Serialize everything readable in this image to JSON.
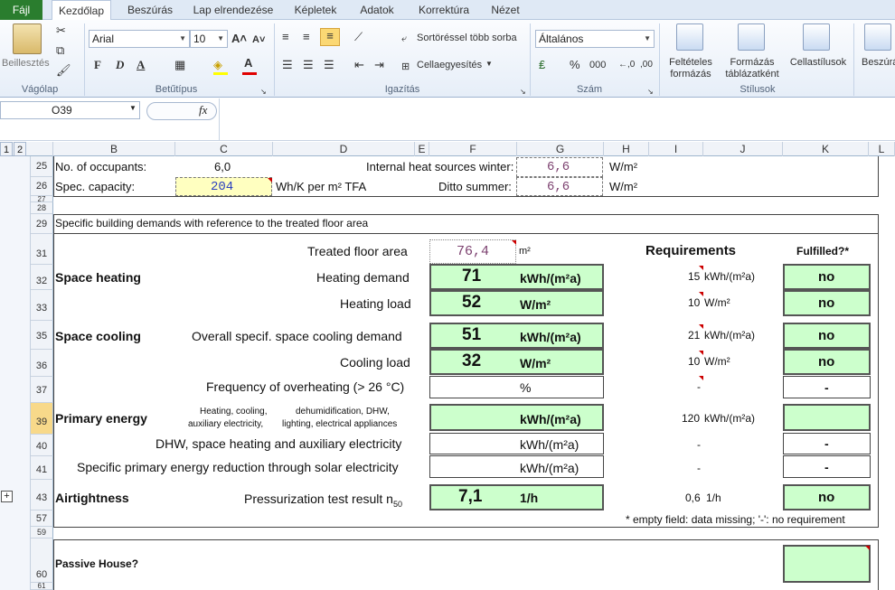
{
  "ribbon": {
    "file_tab": "Fájl",
    "tabs": [
      "Kezdőlap",
      "Beszúrás",
      "Lap elrendezése",
      "Képletek",
      "Adatok",
      "Korrektúra",
      "Nézet"
    ],
    "paste_label": "Beillesztés",
    "font_name": "Arial",
    "font_size": "10",
    "bold_btn": "F",
    "italic_btn": "D",
    "underline_btn": "A",
    "wrap_label": "Sortöréssel több sorba",
    "merge_label": "Cellaegyesítés",
    "number_format": "Általános",
    "percent": "%",
    "thousands": "000",
    "cond_format_l1": "Feltételes",
    "cond_format_l2": "formázás",
    "table_format_l1": "Formázás",
    "table_format_l2": "táblázatként",
    "cell_styles": "Cellastílusok",
    "insert_label": "Beszúrá",
    "groups": [
      "Vágólap",
      "Betűtípus",
      "Igazítás",
      "Szám",
      "Stílusok"
    ]
  },
  "formula_bar": {
    "name_box": "O39",
    "fx": "fx",
    "value": ""
  },
  "outline_levels": [
    "1",
    "2"
  ],
  "outline_expand": "+",
  "columns": [
    "B",
    "C",
    "D",
    "E",
    "F",
    "G",
    "H",
    "I",
    "J",
    "K",
    "L"
  ],
  "rows": [
    "25",
    "26",
    "27",
    "28",
    "29",
    "31",
    "32",
    "33",
    "35",
    "36",
    "37",
    "39",
    "40",
    "41",
    "43",
    "57",
    "59",
    "60",
    "61"
  ],
  "sheet": {
    "r25": {
      "label": "No. of occupants:",
      "value": "6,0",
      "ihs_label": "Internal heat sources winter:",
      "ihs_value": "6,6",
      "ihs_unit": "W/m²"
    },
    "r26": {
      "label": "Spec. capacity:",
      "value": "204",
      "unit": "Wh/K per m² TFA",
      "summer_label": "Ditto summer:",
      "summer_value": "6,6",
      "summer_unit": "W/m²"
    },
    "section_title": "Specific building demands with reference to the treated floor area",
    "tfa_label": "Treated floor area",
    "tfa_value": "76,4",
    "tfa_unit": "m²",
    "requirements_hdr": "Requirements",
    "fulfilled_hdr": "Fulfilled?*",
    "space_heating": "Space heating",
    "heating_demand": {
      "label": "Heating demand",
      "value": "71",
      "unit": "kWh/(m²a)",
      "req": "15",
      "req_unit": "kWh/(m²a)",
      "ok": "no"
    },
    "heating_load": {
      "label": "Heating load",
      "value": "52",
      "unit": "W/m²",
      "req": "10",
      "req_unit": "W/m²",
      "ok": "no"
    },
    "space_cooling": "Space cooling",
    "cooling_demand": {
      "label": "Overall specif. space cooling demand",
      "value": "51",
      "unit": "kWh/(m²a)",
      "req": "21",
      "req_unit": "kWh/(m²a)",
      "ok": "no"
    },
    "cooling_load": {
      "label": "Cooling load",
      "value": "32",
      "unit": "W/m²",
      "req": "10",
      "req_unit": "W/m²",
      "ok": "no"
    },
    "overheating": {
      "label": "Frequency of overheating (> 26 °C)",
      "unit": "%",
      "req": "-",
      "ok": "-"
    },
    "primary_energy": "Primary energy",
    "pe_note1": "Heating, cooling,",
    "pe_note2": "auxiliary electricity,",
    "pe_note3": "dehumidification, DHW,",
    "pe_note4": "lighting, electrical appliances",
    "pe_total": {
      "unit": "kWh/(m²a)",
      "req": "120",
      "req_unit": "kWh/(m²a)",
      "ok": ""
    },
    "pe_dhw": {
      "label": "DHW, space heating and auxiliary electricity",
      "unit": "kWh/(m²a)",
      "req": "-",
      "ok": "-"
    },
    "pe_solar": {
      "label": "Specific primary energy reduction through solar electricity",
      "unit": "kWh/(m²a)",
      "req": "-",
      "ok": "-"
    },
    "airtightness": "Airtightness",
    "pressurization": {
      "label": "Pressurization test result n",
      "sub": "50",
      "value": "7,1",
      "unit": "1/h",
      "req": "0,6",
      "req_unit": "1/h",
      "ok": "no"
    },
    "footnote": "* empty field: data missing; '-': no requirement",
    "passive_house": "Passive House?"
  }
}
